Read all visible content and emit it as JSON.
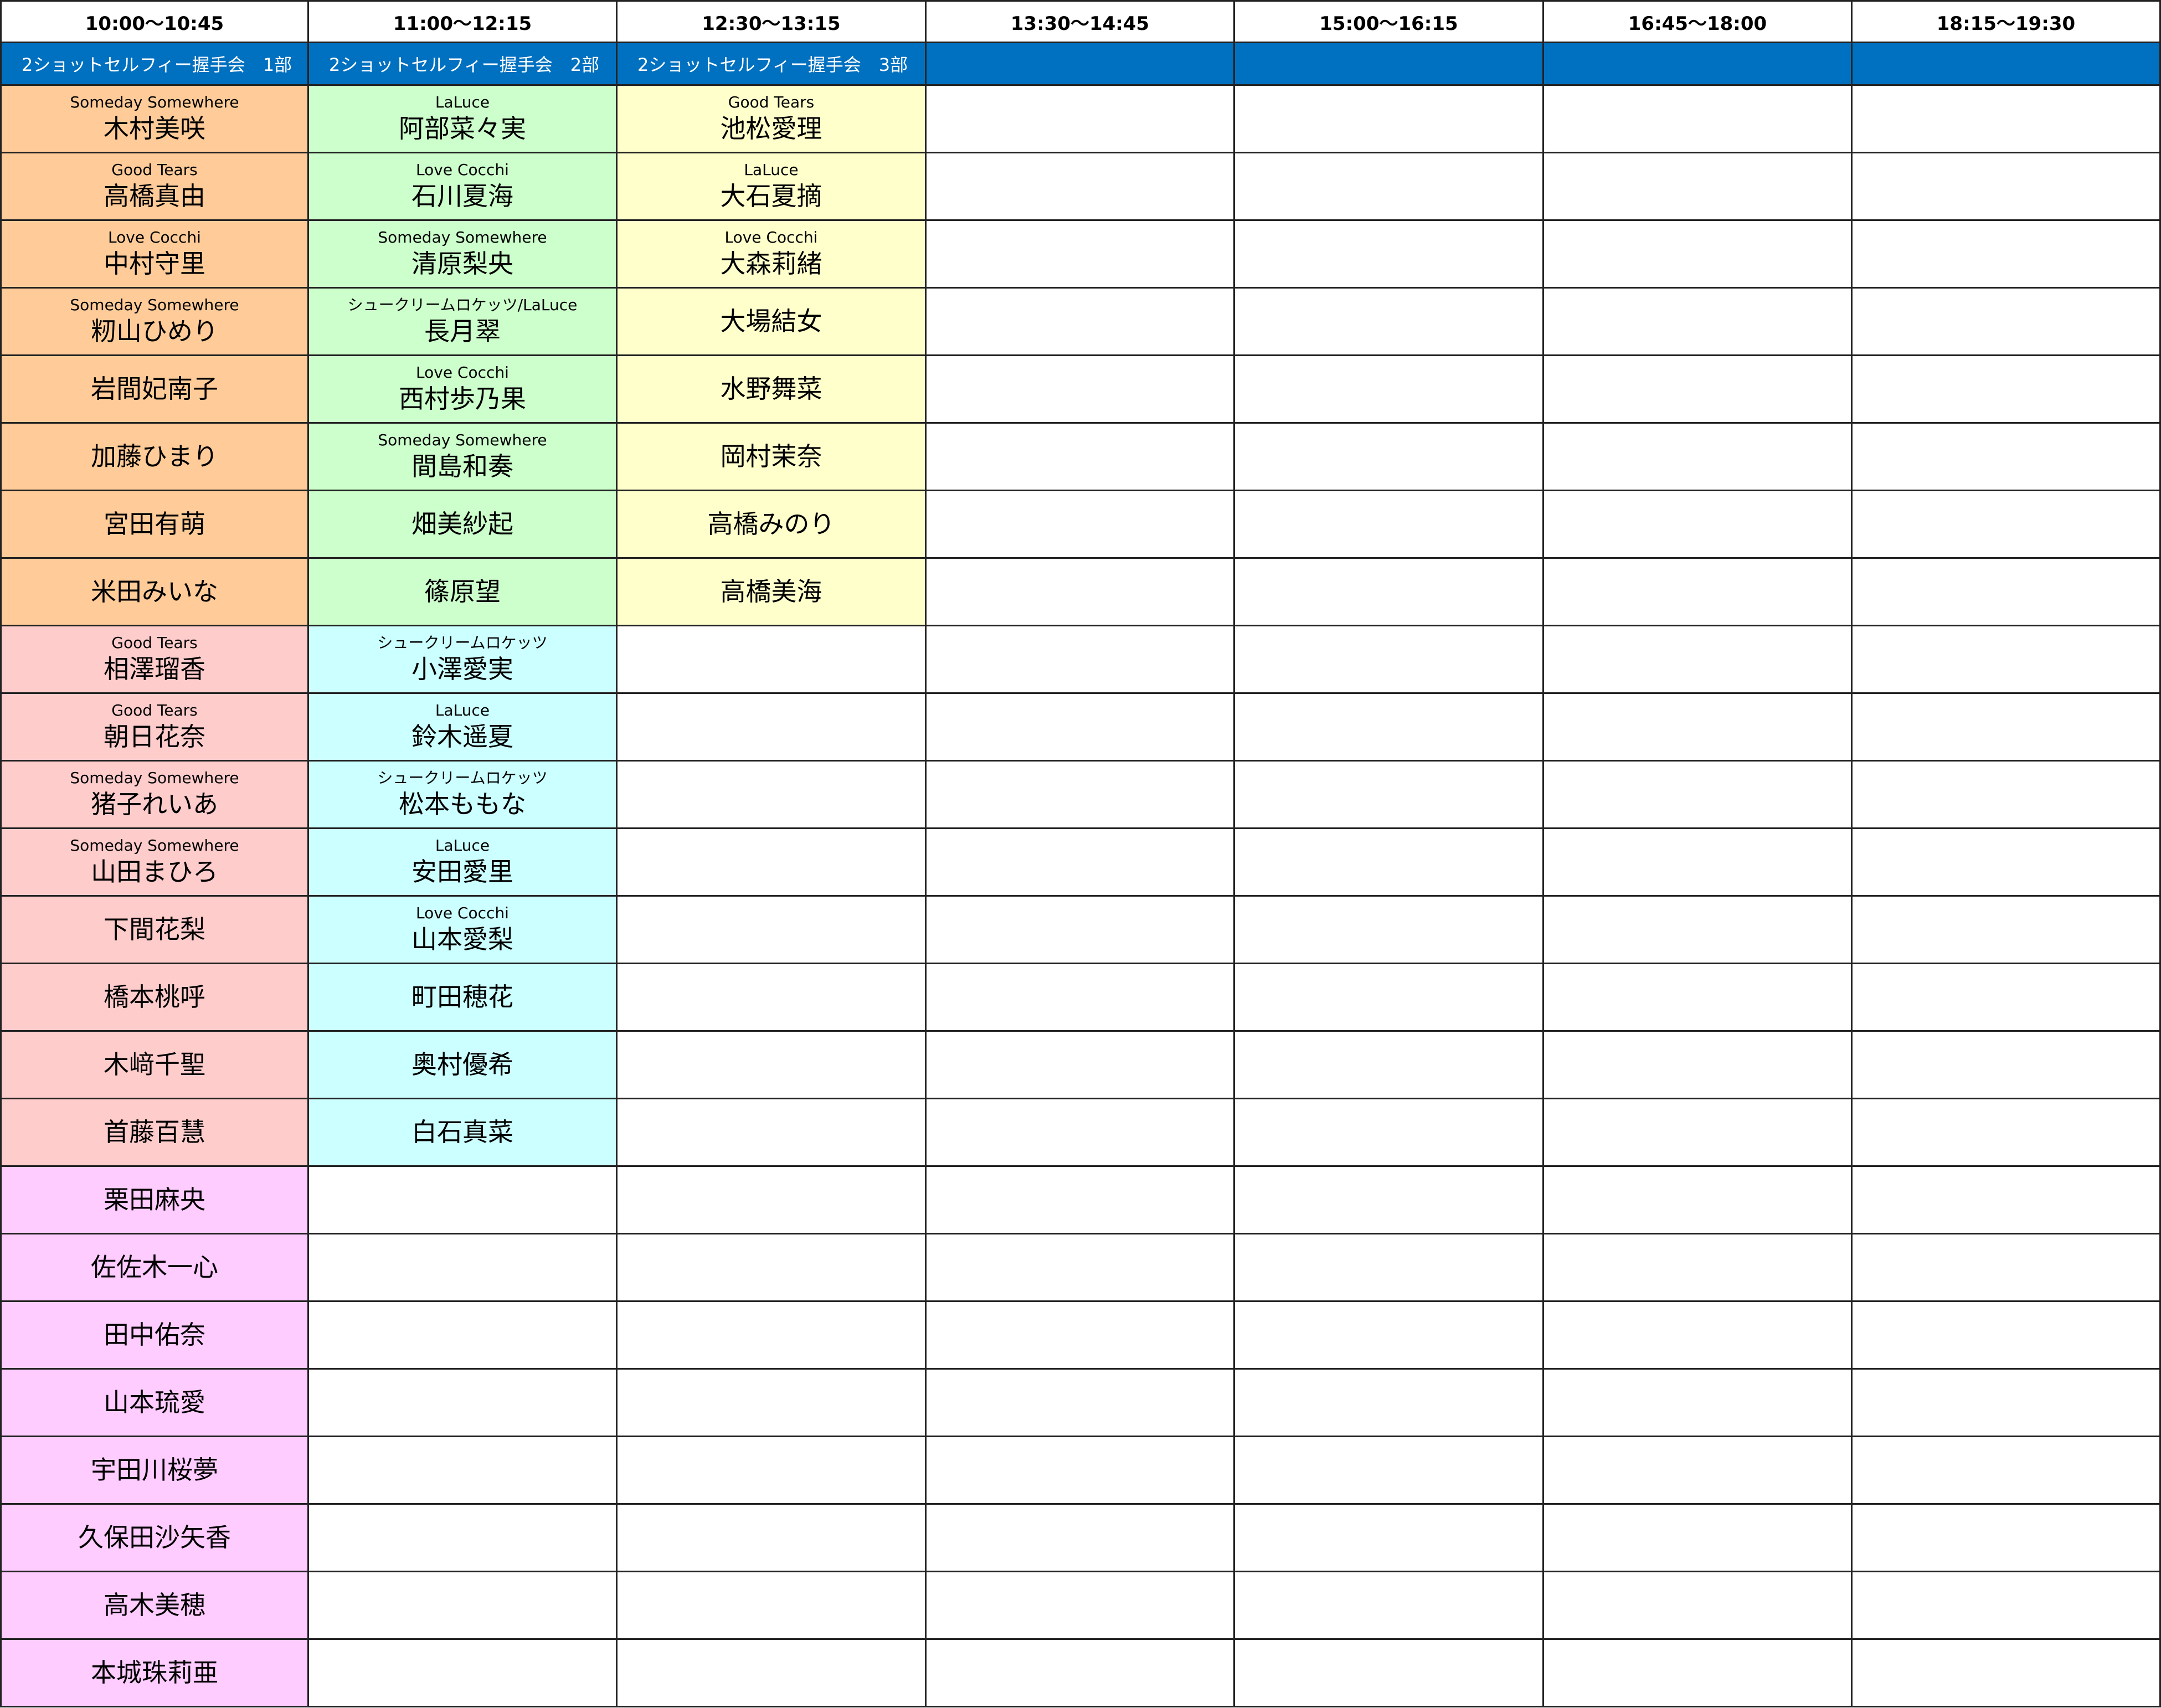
{
  "time_slots": [
    "10:00～10:45",
    "11:00～12:15",
    "12:30～13:15",
    "13:30～14:45",
    "15:00～16:15",
    "16:45～18:00",
    "18:15～19:30"
  ],
  "sessions": [
    "2ショットセルフィー握手会　1部",
    "2ショットセルフィー握手会　2部",
    "2ショットセルフィー握手会　3部",
    "",
    "",
    "",
    ""
  ],
  "colors": {
    "session_bar": "#0070C0",
    "orange": "#FFCC99",
    "green": "#CCFFCC",
    "yellow": "#FFFFCC",
    "pink": "#FFCCCC",
    "cyan": "#CCFFFF",
    "magenta": "#FFCCFF"
  },
  "columns": [
    {
      "members": [
        {
          "group": "Someday Somewhere",
          "name": "木村美咲",
          "color": "orange"
        },
        {
          "group": "Good Tears",
          "name": "高橋真由",
          "color": "orange"
        },
        {
          "group": "Love Cocchi",
          "name": "中村守里",
          "color": "orange"
        },
        {
          "group": "Someday Somewhere",
          "name": "籾山ひめり",
          "color": "orange"
        },
        {
          "group": "",
          "name": "岩間妃南子",
          "color": "orange"
        },
        {
          "group": "",
          "name": "加藤ひまり",
          "color": "orange"
        },
        {
          "group": "",
          "name": "宮田有萌",
          "color": "orange"
        },
        {
          "group": "",
          "name": "米田みいな",
          "color": "orange"
        },
        {
          "group": "Good Tears",
          "name": "相澤瑠香",
          "color": "pink"
        },
        {
          "group": "Good Tears",
          "name": "朝日花奈",
          "color": "pink"
        },
        {
          "group": "Someday Somewhere",
          "name": "猪子れいあ",
          "color": "pink"
        },
        {
          "group": "Someday Somewhere",
          "name": "山田まひろ",
          "color": "pink"
        },
        {
          "group": "",
          "name": "下間花梨",
          "color": "pink"
        },
        {
          "group": "",
          "name": "橋本桃呼",
          "color": "pink"
        },
        {
          "group": "",
          "name": "木﨑千聖",
          "color": "pink"
        },
        {
          "group": "",
          "name": "首藤百慧",
          "color": "pink"
        },
        {
          "group": "",
          "name": "栗田麻央",
          "color": "magenta"
        },
        {
          "group": "",
          "name": "佐佐木一心",
          "color": "magenta"
        },
        {
          "group": "",
          "name": "田中佑奈",
          "color": "magenta"
        },
        {
          "group": "",
          "name": "山本琉愛",
          "color": "magenta"
        },
        {
          "group": "",
          "name": "宇田川桜夢",
          "color": "magenta"
        },
        {
          "group": "",
          "name": "久保田沙矢香",
          "color": "magenta"
        },
        {
          "group": "",
          "name": "高木美穂",
          "color": "magenta"
        },
        {
          "group": "",
          "name": "本城珠莉亜",
          "color": "magenta"
        }
      ]
    },
    {
      "members": [
        {
          "group": "LaLuce",
          "name": "阿部菜々実",
          "color": "green"
        },
        {
          "group": "Love Cocchi",
          "name": "石川夏海",
          "color": "green"
        },
        {
          "group": "Someday Somewhere",
          "name": "清原梨央",
          "color": "green"
        },
        {
          "group": "シュークリームロケッツ/LaLuce",
          "name": "長月翠",
          "color": "green"
        },
        {
          "group": "Love Cocchi",
          "name": "西村歩乃果",
          "color": "green"
        },
        {
          "group": "Someday Somewhere",
          "name": "間島和奏",
          "color": "green"
        },
        {
          "group": "",
          "name": "畑美紗起",
          "color": "green"
        },
        {
          "group": "",
          "name": "篠原望",
          "color": "green"
        },
        {
          "group": "シュークリームロケッツ",
          "name": "小澤愛実",
          "color": "cyan"
        },
        {
          "group": "LaLuce",
          "name": "鈴木遥夏",
          "color": "cyan"
        },
        {
          "group": "シュークリームロケッツ",
          "name": "松本ももな",
          "color": "cyan"
        },
        {
          "group": "LaLuce",
          "name": "安田愛里",
          "color": "cyan"
        },
        {
          "group": "Love Cocchi",
          "name": "山本愛梨",
          "color": "cyan"
        },
        {
          "group": "",
          "name": "町田穂花",
          "color": "cyan"
        },
        {
          "group": "",
          "name": "奥村優希",
          "color": "cyan"
        },
        {
          "group": "",
          "name": "白石真菜",
          "color": "cyan"
        }
      ]
    },
    {
      "members": [
        {
          "group": "Good Tears",
          "name": "池松愛理",
          "color": "yellow"
        },
        {
          "group": "LaLuce",
          "name": "大石夏摘",
          "color": "yellow"
        },
        {
          "group": "Love Cocchi",
          "name": "大森莉緒",
          "color": "yellow"
        },
        {
          "group": "",
          "name": "大場結女",
          "color": "yellow"
        },
        {
          "group": "",
          "name": "水野舞菜",
          "color": "yellow"
        },
        {
          "group": "",
          "name": "岡村茉奈",
          "color": "yellow"
        },
        {
          "group": "",
          "name": "高橋みのり",
          "color": "yellow"
        },
        {
          "group": "",
          "name": "高橋美海",
          "color": "yellow"
        }
      ]
    },
    {
      "members": []
    },
    {
      "members": []
    },
    {
      "members": []
    },
    {
      "members": []
    }
  ]
}
